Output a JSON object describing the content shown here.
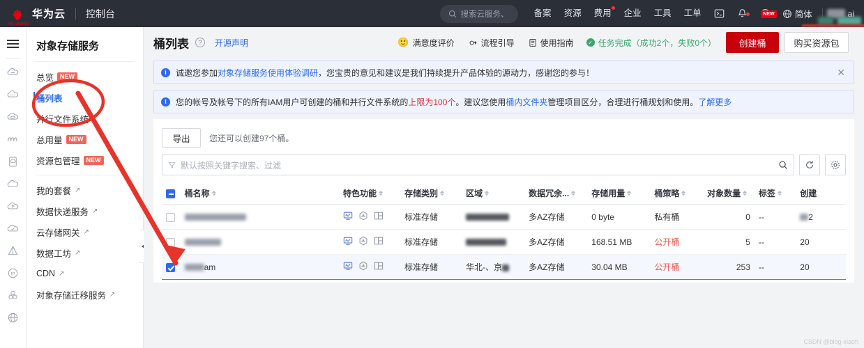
{
  "topbar": {
    "brand_cn": "华为云",
    "brand_word": "HUAWEI",
    "console": "控制台",
    "search_placeholder": "搜索云服务、",
    "links": [
      {
        "label": "备案",
        "dot": false
      },
      {
        "label": "资源",
        "dot": false
      },
      {
        "label": "费用",
        "dot": true
      },
      {
        "label": "企业",
        "dot": false
      },
      {
        "label": "工具",
        "dot": false
      },
      {
        "label": "工单",
        "dot": false
      }
    ],
    "icons": [
      {
        "name": "cloudshell-icon",
        "badge": ""
      },
      {
        "name": "bell-icon",
        "badge": ""
      },
      {
        "name": "help-icon",
        "badge": "NEW"
      }
    ],
    "language": "简体",
    "ai_label": "ai"
  },
  "rail": {
    "menu_icon": "hamburger-icon",
    "icons": [
      "cloud-server-icon",
      "cloud-dots-icon",
      "cloud-disk-icon",
      "wave-icon",
      "storage-card-icon",
      "cloud-plain-icon",
      "cloud-upload-icon",
      "cloud-check-icon",
      "pyramid-icon",
      "ip-circle-icon",
      "cluster-icon",
      "globe-icon"
    ]
  },
  "service_nav": {
    "title": "对象存储服务",
    "items": [
      {
        "label": "总览",
        "badge": "NEW",
        "external": false,
        "active": false
      },
      {
        "label": "桶列表",
        "badge": "",
        "external": false,
        "active": true
      },
      {
        "label": "并行文件系统",
        "badge": "",
        "external": false,
        "active": false
      },
      {
        "label": "总用量",
        "badge": "NEW",
        "external": false,
        "active": false
      },
      {
        "label": "资源包管理",
        "badge": "NEW",
        "external": false,
        "active": false
      },
      {
        "label": "我的套餐",
        "badge": "",
        "external": true,
        "active": false
      },
      {
        "label": "数据快递服务",
        "badge": "",
        "external": true,
        "active": false
      },
      {
        "label": "云存储网关",
        "badge": "",
        "external": true,
        "active": false
      },
      {
        "label": "数据工坊",
        "badge": "",
        "external": true,
        "active": false
      },
      {
        "label": "CDN",
        "badge": "",
        "external": true,
        "active": false
      },
      {
        "label": "对象存储迁移服务",
        "badge": "",
        "external": true,
        "active": false
      }
    ]
  },
  "page_header": {
    "title": "桶列表",
    "help_icon": "question-icon",
    "open_source": "开源声明",
    "actions": [
      {
        "label": "满意度评价",
        "icon": "smiley-icon"
      },
      {
        "label": "流程引导",
        "icon": "guide-icon"
      },
      {
        "label": "使用指南",
        "icon": "doc-icon"
      }
    ],
    "task_status": "任务完成（成功2个，失败0个）",
    "create_button": "创建桶",
    "buy_button": "购买资源包"
  },
  "alerts": [
    {
      "prefix": "诚邀您参加",
      "link": "对象存储服务使用体验调研",
      "suffix": "，您宝贵的意见和建议是我们持续提升产品体验的源动力，感谢您的参与！",
      "closable": true
    },
    {
      "part1": "您的帐号及帐号下的所有IAM用户可创建的桶和并行文件系统的",
      "highlight": "上限为100个",
      "part2": "。建议您使用",
      "link1": "桶内文件夹",
      "part3": "管理项目区分，合理进行桶规划和使用。",
      "link2": "了解更多",
      "closable": false
    }
  ],
  "toolbar": {
    "export_label": "导出",
    "tip": "您还可以创建97个桶。",
    "search_placeholder": "默认按照关键字搜索、过滤",
    "search_icon": "magnifier-icon",
    "refresh_icon": "refresh-icon",
    "settings_icon": "gear-icon",
    "filter_icon": "funnel-icon"
  },
  "table": {
    "columns": [
      {
        "label": "桶名称",
        "sortable": true
      },
      {
        "label": "特色功能",
        "sortable": true
      },
      {
        "label": "存储类别",
        "sortable": true
      },
      {
        "label": "区域",
        "sortable": true
      },
      {
        "label": "数据冗余...",
        "sortable": true
      },
      {
        "label": "存储用量",
        "sortable": true
      },
      {
        "label": "桶策略",
        "sortable": true
      },
      {
        "label": "对象数量",
        "sortable": true
      },
      {
        "label": "标签",
        "sortable": true
      },
      {
        "label": "创建",
        "sortable": false
      }
    ],
    "header_checkbox": "indeterminate",
    "feature_icons": [
      "monitor-chart-icon",
      "cdn-hex-icon",
      "layout-grid-icon"
    ],
    "rows": [
      {
        "selected": false,
        "name": "",
        "name_redacted": true,
        "storage_class": "标准存储",
        "region": "",
        "region_redacted": true,
        "redundancy": "多AZ存储",
        "usage": "0 byte",
        "policy": "私有桶",
        "policy_public": false,
        "objects": "0",
        "tag": "--",
        "created": "2"
      },
      {
        "selected": false,
        "name": "",
        "name_redacted": true,
        "storage_class": "标准存储",
        "region": "",
        "region_redacted": true,
        "redundancy": "多AZ存储",
        "usage": "168.51 MB",
        "policy": "公开桶",
        "policy_public": true,
        "objects": "5",
        "tag": "--",
        "created": "20"
      },
      {
        "selected": true,
        "name": "am",
        "name_redacted": true,
        "storage_class": "标准存储",
        "region": "华北-、京",
        "region_redacted": true,
        "redundancy": "多AZ存储",
        "usage": "30.04 MB",
        "policy": "公开桶",
        "policy_public": true,
        "objects": "253",
        "tag": "--",
        "created": "20"
      }
    ]
  },
  "watermark": "CSDN @blog-xiaoh",
  "colors": {
    "brand_red": "#c7000b",
    "link_blue": "#2c6bed",
    "annotation_red": "#e8332a",
    "success_green": "#3aa76d",
    "badge_red": "#f06659"
  }
}
